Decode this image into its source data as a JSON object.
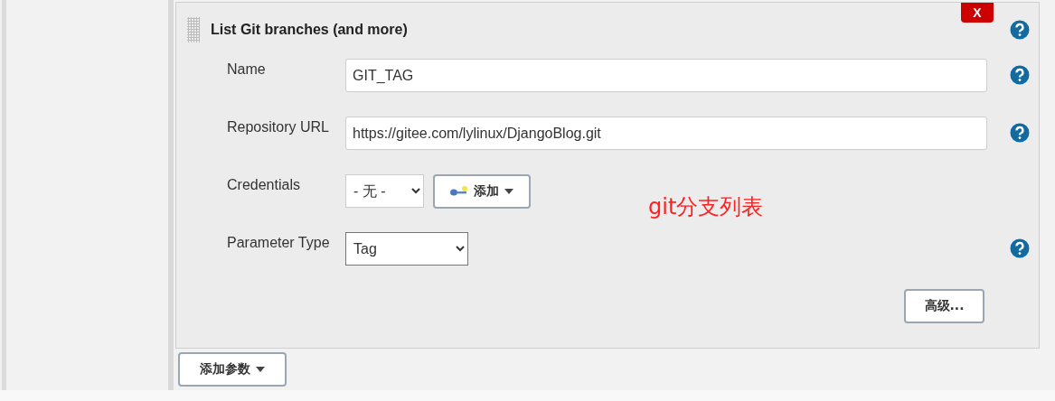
{
  "panel": {
    "title": "List Git branches (and more)",
    "delete_button": "X",
    "has_help": true
  },
  "fields": [
    {
      "kind": "text",
      "label": "Name",
      "value": "GIT_TAG",
      "has_help": true
    },
    {
      "kind": "text",
      "label": "Repository URL",
      "value": "https://gitee.com/lylinux/DjangoBlog.git",
      "has_help": true
    },
    {
      "kind": "credentials",
      "label": "Credentials",
      "value": "- 无 -",
      "add_button": "添加",
      "has_help": false
    },
    {
      "kind": "select",
      "label": "Parameter Type",
      "value": "Tag",
      "has_help": true
    }
  ],
  "annotation": "git分支列表",
  "advanced_button": "高级...",
  "add_parameter_button": "添加参数"
}
